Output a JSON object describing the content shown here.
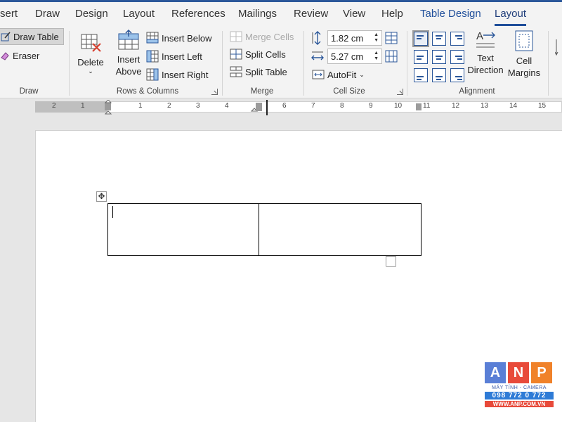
{
  "tabs": [
    "sert",
    "Draw",
    "Design",
    "Layout",
    "References",
    "Mailings",
    "Review",
    "View",
    "Help",
    "Table Design",
    "Layout"
  ],
  "active_tab": "Layout",
  "groups": {
    "draw": {
      "label": "Draw",
      "draw_table": "Draw Table",
      "eraser": "Eraser"
    },
    "rows_columns": {
      "label": "Rows & Columns",
      "delete": "Delete",
      "insert_above_line1": "Insert",
      "insert_above_line2": "Above",
      "insert_below": "Insert Below",
      "insert_left": "Insert Left",
      "insert_right": "Insert Right"
    },
    "merge": {
      "label": "Merge",
      "merge_cells": "Merge Cells",
      "split_cells": "Split Cells",
      "split_table": "Split Table"
    },
    "cell_size": {
      "label": "Cell Size",
      "height": "1.82 cm",
      "width": "5.27 cm",
      "autofit": "AutoFit"
    },
    "alignment": {
      "label": "Alignment",
      "text_direction_line1": "Text",
      "text_direction_line2": "Direction",
      "cell_margins_line1": "Cell",
      "cell_margins_line2": "Margins",
      "selected_cell": "top-left"
    }
  },
  "ruler_labels": [
    "2",
    "1",
    "1",
    "2",
    "3",
    "4",
    "6",
    "7",
    "8",
    "9",
    "10",
    "11",
    "12",
    "13",
    "14",
    "15"
  ],
  "document": {
    "table_rows": 1,
    "table_cols": 2
  },
  "logo": {
    "letters": [
      "A",
      "N",
      "P"
    ],
    "tagline": "MÁY TÍNH - CAMERA",
    "phone": "098 772 0 772",
    "url": "WWW.ANP.COM.VN"
  },
  "colors": {
    "accent": "#2b579a",
    "logo_a": "#5a7fd6",
    "logo_n": "#e84a3a",
    "logo_p": "#f0822a"
  }
}
